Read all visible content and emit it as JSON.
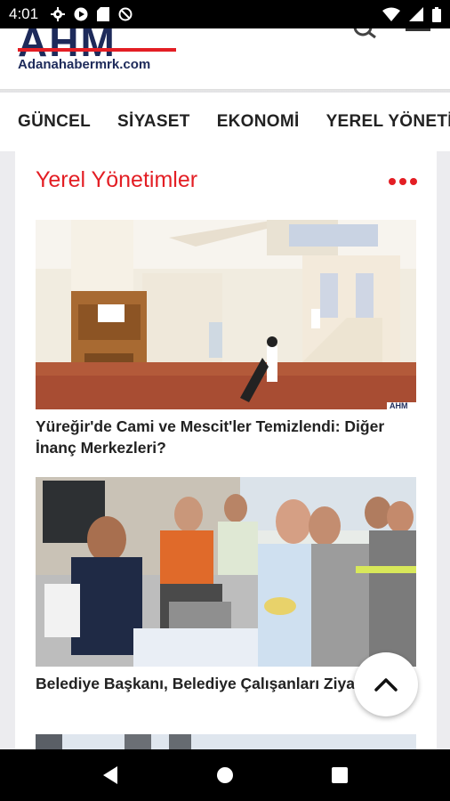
{
  "status_bar": {
    "time": "4:01",
    "left_icons": [
      "gear-icon",
      "play-icon",
      "sd-card-icon",
      "blocked-icon"
    ],
    "right_icons": [
      "wifi-icon",
      "signal-icon",
      "battery-icon"
    ]
  },
  "header": {
    "logo_text": "AHM",
    "logo_subtitle": "Adanahabermrk.com",
    "icons": [
      "search-icon",
      "menu-icon"
    ]
  },
  "categories": [
    "GÜNCEL",
    "SİYASET",
    "EKONOMİ",
    "YEREL YÖNETİMLER"
  ],
  "section": {
    "title": "Yerel Yönetimler"
  },
  "articles": [
    {
      "title": "Yüreğir'de Cami ve Mescit'ler Temizlendi: Diğer İnanç Merkezleri?",
      "image_watermark": "AHM"
    },
    {
      "title": "Belediye Başkanı, Belediye Çalışanları Ziyaret Etti!"
    }
  ],
  "colors": {
    "accent": "#e31e24",
    "logo_navy": "#1d2a5a",
    "background": "#ececef"
  }
}
